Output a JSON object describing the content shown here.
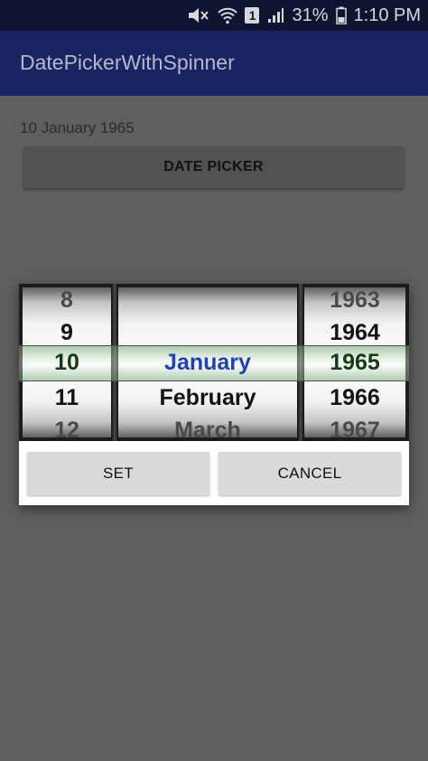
{
  "status_bar": {
    "icons": [
      "mute-icon",
      "wifi-icon",
      "sim-1-icon",
      "signal-icon",
      "battery-icon"
    ],
    "sim_label": "1",
    "battery": "31%",
    "time": "1:10 PM"
  },
  "app_bar": {
    "title": "DatePickerWithSpinner"
  },
  "content": {
    "selected_date": "10 January 1965",
    "date_picker_button": "DATE PICKER"
  },
  "dialog": {
    "day_column": [
      "8",
      "9",
      "10",
      "11",
      "12"
    ],
    "month_column": [
      "",
      "",
      "January",
      "February",
      "March"
    ],
    "year_column": [
      "1963",
      "1964",
      "1965",
      "1966",
      "1967"
    ],
    "selected": {
      "day": "10",
      "month": "January",
      "year": "1965"
    },
    "set_button": "SET",
    "cancel_button": "CANCEL"
  },
  "colors": {
    "status_bar": "#0e1530",
    "app_bar": "#1a2462",
    "selected_month": "#1f3fc0",
    "selected_band": "#8fbf8f",
    "background": "#5f5f5f"
  }
}
